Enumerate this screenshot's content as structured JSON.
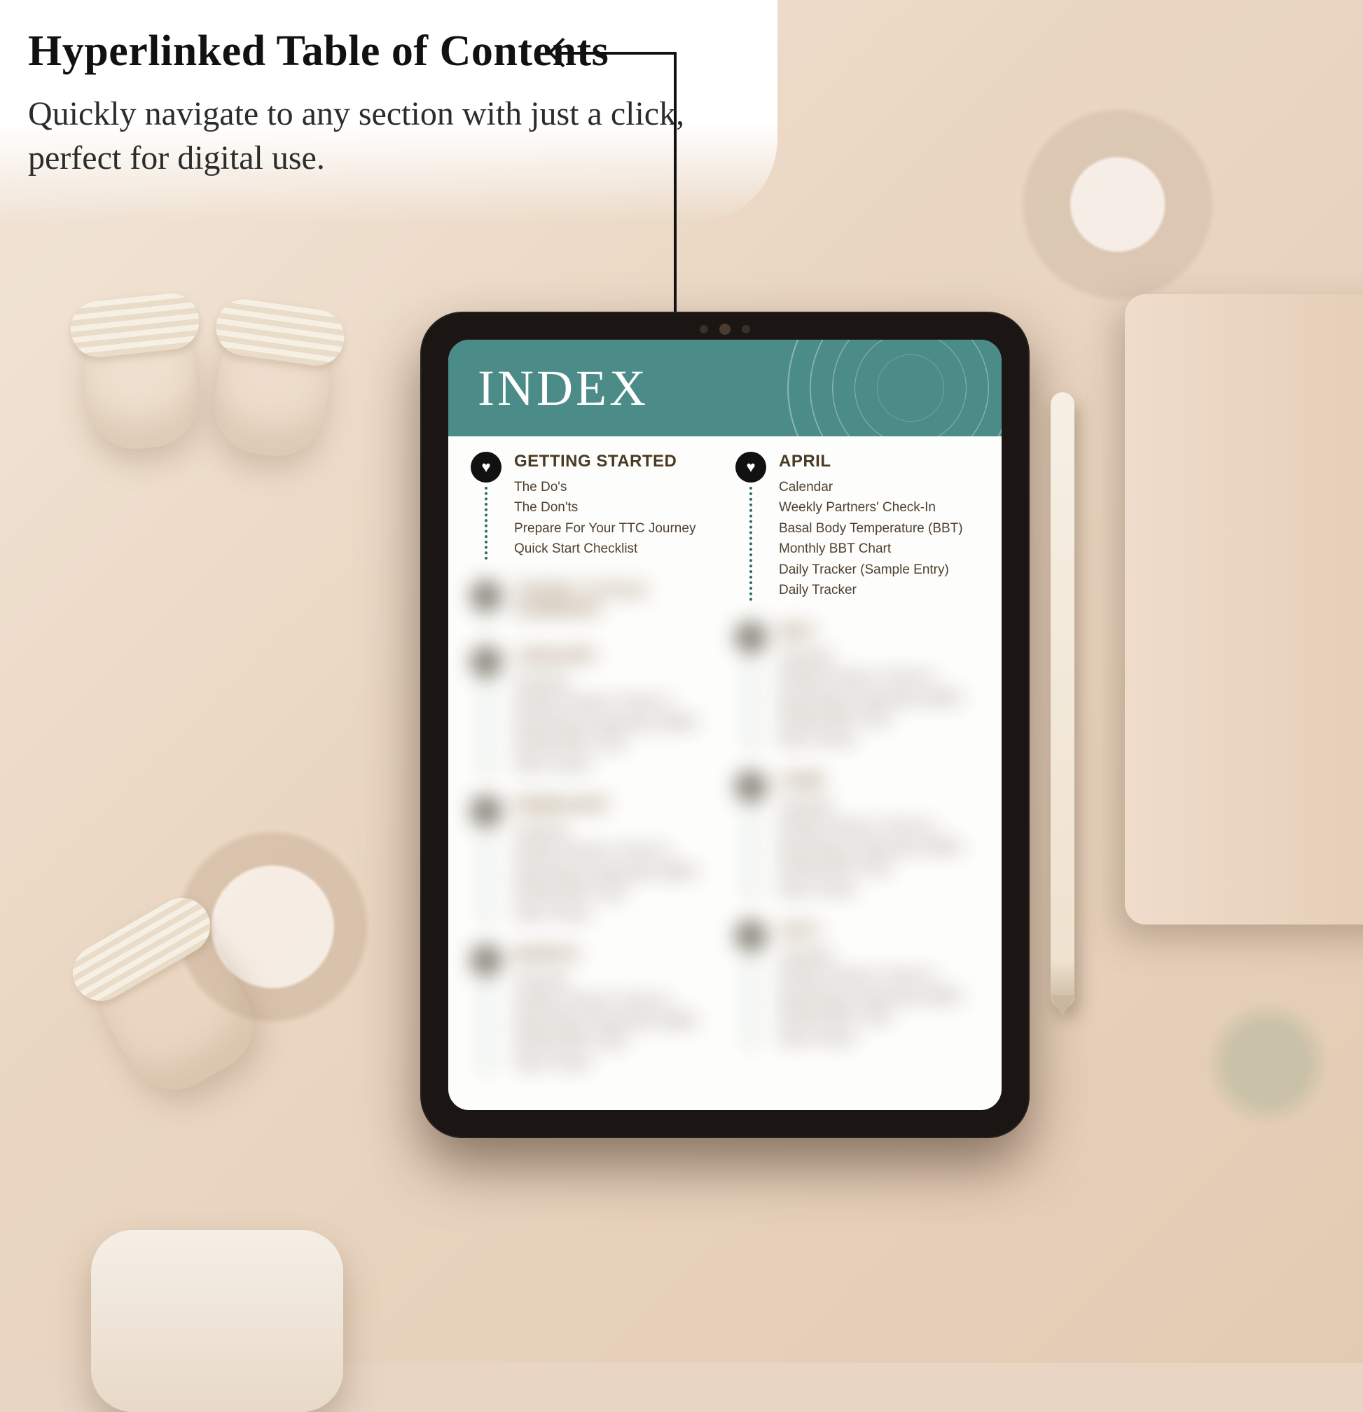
{
  "callout": {
    "title": "Hyperlinked Table of Contents",
    "body": "Quickly navigate to any section with just a click, perfect for digital use."
  },
  "tablet": {
    "header": "INDEX",
    "columns": [
      {
        "sections": [
          {
            "title": "GETTING STARTED",
            "blur": false,
            "items": [
              "The Do's",
              "The Don'ts",
              "Prepare For Your TTC Journey",
              "Quick Start Checklist"
            ]
          },
          {
            "title": "YEARLY CYCLE SUMMARY",
            "blur": true,
            "items": [
              ""
            ]
          },
          {
            "title": "JANUARY",
            "blur": true,
            "items": [
              "Calendar",
              "Weekly Partners' Check-In",
              "Basal Body Temperature (BBT)",
              "Monthly BBT Chart",
              "Daily Tracker"
            ]
          },
          {
            "title": "FEBRUARY",
            "blur": true,
            "items": [
              "Calendar",
              "Weekly Partners' Check-In",
              "Basal Body Temperature (BBT)",
              "Monthly BBT Chart",
              "Daily Tracker"
            ]
          },
          {
            "title": "MARCH",
            "blur": true,
            "items": [
              "Calendar",
              "Weekly Partners' Check-In",
              "Basal Body Temperature (BBT)",
              "Monthly BBT Chart",
              "Daily Tracker"
            ]
          }
        ]
      },
      {
        "sections": [
          {
            "title": "APRIL",
            "blur": false,
            "items": [
              "Calendar",
              "Weekly Partners' Check-In",
              "Basal Body Temperature (BBT)",
              "Monthly BBT Chart",
              "Daily Tracker (Sample Entry)",
              "Daily Tracker"
            ]
          },
          {
            "title": "MAY",
            "blur": true,
            "items": [
              "Calendar",
              "Weekly Partners' Check-In",
              "Basal Body Temperature (BBT)",
              "Monthly BBT Chart",
              "Daily Tracker"
            ]
          },
          {
            "title": "JUNE",
            "blur": true,
            "items": [
              "Calendar",
              "Weekly Partners' Check-In",
              "Basal Body Temperature (BBT)",
              "Monthly BBT Chart",
              "Daily Tracker"
            ]
          },
          {
            "title": "JULY",
            "blur": true,
            "items": [
              "Calendar",
              "Weekly Partners' Check-In",
              "Basal Body Temperature (BBT)",
              "Monthly BBT Chart",
              "Daily Tracker"
            ]
          }
        ]
      }
    ]
  }
}
